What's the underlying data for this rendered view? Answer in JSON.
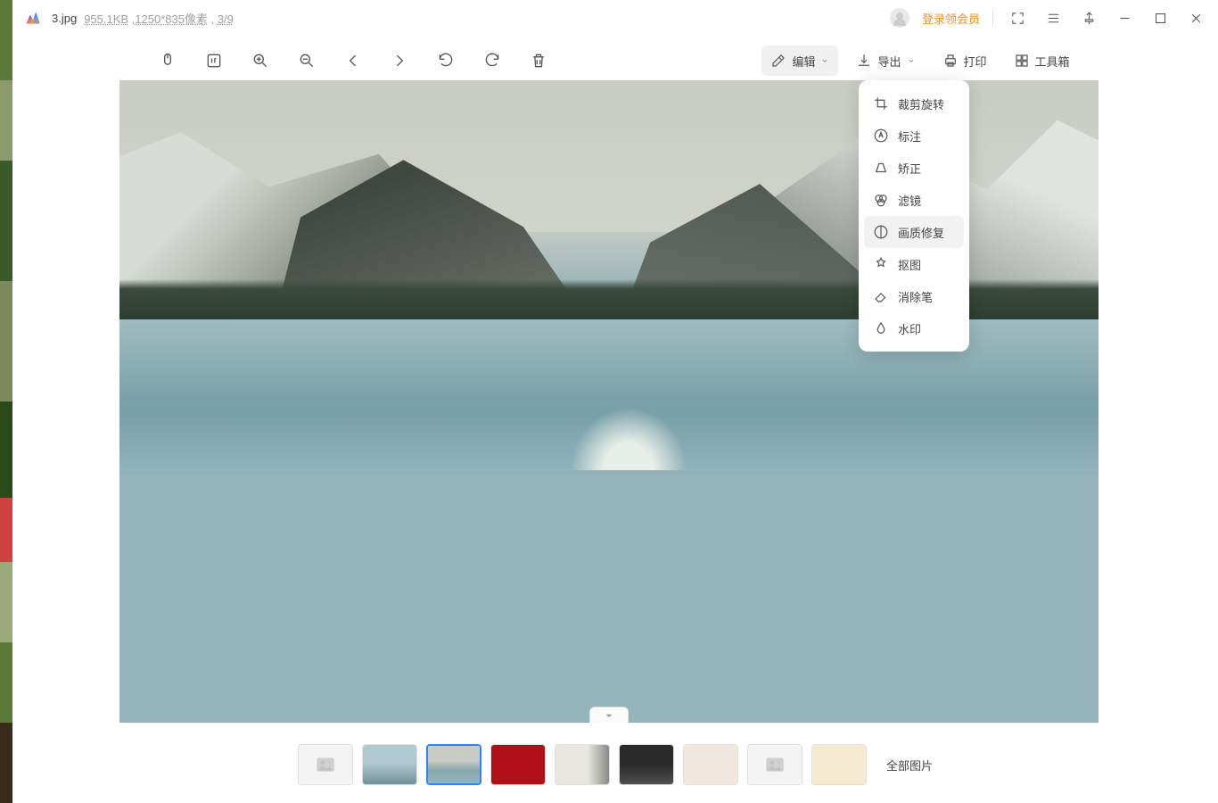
{
  "title": {
    "filename": "3.jpg",
    "filesize": "955.1KB",
    "dimensions": "1250*835像素",
    "index": "3/9"
  },
  "header": {
    "vip": "登录领会员"
  },
  "toolbar": {
    "edit": "编辑",
    "export": "导出",
    "print": "打印",
    "toolbox": "工具箱"
  },
  "edit_menu": {
    "items": [
      {
        "id": "crop",
        "label": "裁剪旋转"
      },
      {
        "id": "annotate",
        "label": "标注"
      },
      {
        "id": "straighten",
        "label": "矫正"
      },
      {
        "id": "filter",
        "label": "滤镜"
      },
      {
        "id": "quality",
        "label": "画质修复",
        "selected": true
      },
      {
        "id": "cutout",
        "label": "抠图"
      },
      {
        "id": "eraser",
        "label": "消除笔"
      },
      {
        "id": "watermark",
        "label": "水印"
      }
    ]
  },
  "thumbs": {
    "all": "全部图片"
  }
}
